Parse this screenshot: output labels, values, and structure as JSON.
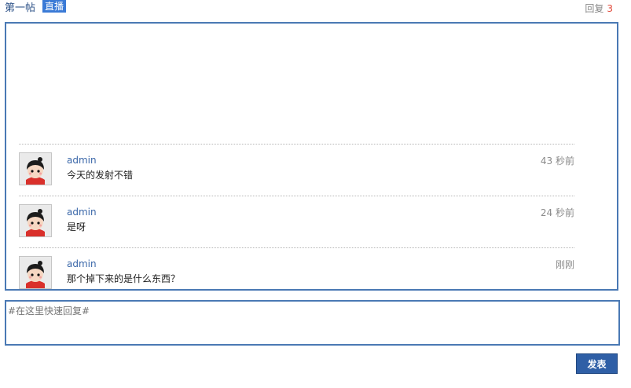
{
  "header": {
    "title": "第一帖",
    "badge": "直播",
    "reply_label": "回复",
    "reply_count": "3"
  },
  "posts": [
    {
      "user": "admin",
      "message": "今天的发射不错",
      "time": "43 秒前"
    },
    {
      "user": "admin",
      "message": "是呀",
      "time": "24 秒前"
    },
    {
      "user": "admin",
      "message": "那个掉下来的是什么东西？",
      "time": "刚刚"
    }
  ],
  "reply": {
    "placeholder": "#在这里快速回复#",
    "submit_label": "发表"
  },
  "colors": {
    "border": "#4a79b4",
    "badge": "#3a7ad6",
    "username": "#3a67a9",
    "count": "#e24a3b",
    "button": "#2f5fa6"
  }
}
